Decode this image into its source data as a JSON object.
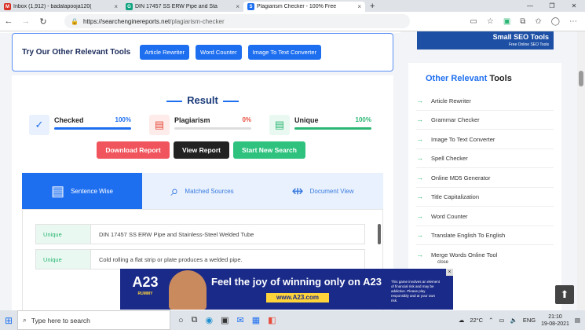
{
  "browser": {
    "tabs": [
      {
        "title": "Inbox (1,912) - badalapooja120(",
        "icon_color": "#d93025",
        "icon_char": "M"
      },
      {
        "title": "DIN 17457 SS ERW Pipe and Sta",
        "icon_color": "#10a37f",
        "icon_char": "G"
      },
      {
        "title": "Plagiarism Checker - 100% Free",
        "icon_color": "#1e6ff0",
        "icon_char": "S"
      }
    ],
    "new_tab": "+",
    "url_host": "https://searchenginereports.net",
    "url_path": "/plagiarism-checker"
  },
  "tools_bar": {
    "heading": "Try Our Other Relevant Tools",
    "buttons": [
      "Article Rewriter",
      "Word Counter",
      "Image To Text Converter"
    ]
  },
  "result": {
    "title": "Result",
    "stats": [
      {
        "name": "Checked",
        "percent": "100%",
        "fill": 1.0,
        "color": "#1e6ff0",
        "bg": "#e8f1fd"
      },
      {
        "name": "Plagiarism",
        "percent": "0%",
        "fill": 0.0,
        "color": "#e74c3c",
        "bg": "#fdecea"
      },
      {
        "name": "Unique",
        "percent": "100%",
        "fill": 1.0,
        "color": "#2bb673",
        "bg": "#e9f9f1"
      }
    ],
    "actions": [
      {
        "label": "Download Report",
        "color": "#f0545c"
      },
      {
        "label": "View Report",
        "color": "#222222"
      },
      {
        "label": "Start New Search",
        "color": "#2ec27e"
      }
    ],
    "tabs": [
      "Sentence Wise",
      "Matched Sources",
      "Document View"
    ],
    "rows": [
      {
        "status": "Unique",
        "text": "DIN 17457 SS ERW Pipe and Stainless-Steel Welded Tube"
      },
      {
        "status": "Unique",
        "text": "Cold rolling a flat strip or plate produces a welded pipe."
      }
    ]
  },
  "sidebar": {
    "ad_title": "Small SEO Tools",
    "ad_sub": "Free Online SEO Tools",
    "heading_blue": "Other Relevant",
    "heading_dark": "Tools",
    "items": [
      "Article Rewriter",
      "Grammar Checker",
      "Image To Text Converter",
      "Spell Checker",
      "Online MD5 Generator",
      "Title Capitalization",
      "Word Counter",
      "Translate English To English",
      "Merge Words Online Tool"
    ]
  },
  "ad": {
    "brand": "A23",
    "brand_sub": "RUMMY",
    "headline": "Feel the joy of winning only on A23",
    "domain": "www.A23.com",
    "fine_print": "This game involves an element of financial risk and may be addictive. Please play responsibly and at your own risk.",
    "close_label": "close"
  },
  "taskbar": {
    "search_placeholder": "Type here to search",
    "weather": "22°C",
    "lang": "ENG",
    "time": "21:10",
    "date": "19-08-2021"
  }
}
